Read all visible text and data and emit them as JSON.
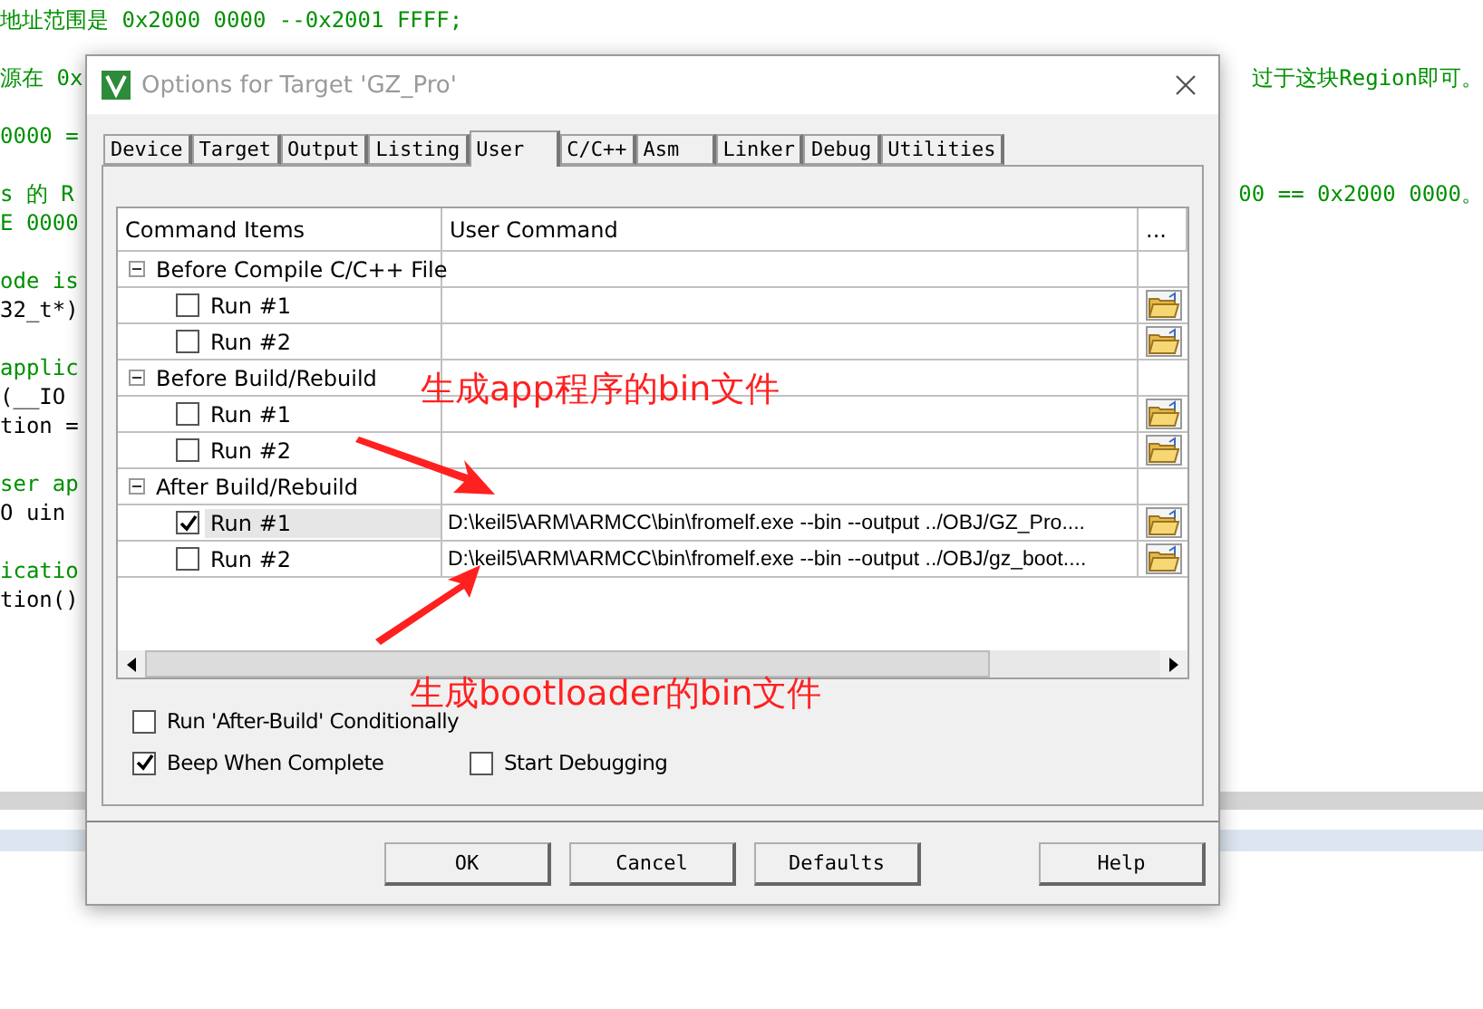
{
  "editor": {
    "blocks": [
      [
        {
          "text": "地址范围是 0x2000 0000  --0x2001 FFFF;",
          "kind": "comment"
        }
      ],
      [
        {
          "text": "源在 0x",
          "kind": "comment",
          "tail": "过于这块Region即可。"
        }
      ],
      [
        {
          "text": "0000 =",
          "kind": "comment"
        }
      ],
      [
        {
          "text": "s 的 R",
          "kind": "comment",
          "tail": "00 == 0x2000 0000。"
        },
        {
          "text": "E 0000",
          "kind": "comment"
        }
      ],
      [
        {
          "text": "ode is",
          "kind": "comment"
        },
        {
          "text": "32_t*)",
          "kind": "code"
        }
      ],
      [
        {
          "text": "applic",
          "kind": "comment"
        },
        {
          "text": "(__IO",
          "kind": "code"
        },
        {
          "text": "tion =",
          "kind": "code"
        }
      ],
      [
        {
          "text": "ser ap",
          "kind": "comment"
        },
        {
          "text": "O uin",
          "kind": "code"
        }
      ],
      [
        {
          "text": "icatio",
          "kind": "comment"
        },
        {
          "text": "tion()",
          "kind": "code"
        }
      ]
    ]
  },
  "dialog": {
    "title": "Options for Target 'GZ_Pro'",
    "tabs": [
      {
        "label": "Device",
        "selected": false
      },
      {
        "label": "Target",
        "selected": false
      },
      {
        "label": "Output",
        "selected": false
      },
      {
        "label": "Listing",
        "selected": false
      },
      {
        "label": "User",
        "selected": true
      },
      {
        "label": "C/C++",
        "selected": false
      },
      {
        "label": "Asm",
        "selected": false
      },
      {
        "label": "Linker",
        "selected": false
      },
      {
        "label": "Debug",
        "selected": false
      },
      {
        "label": "Utilities",
        "selected": false
      }
    ],
    "table": {
      "columns": [
        "Command Items",
        "User Command",
        "..."
      ],
      "groups": [
        {
          "label": "Before Compile C/C++ File",
          "expanded": true,
          "children": [
            {
              "label": "Run #1",
              "checked": false,
              "selected": false
            },
            {
              "label": "Run #2",
              "checked": false,
              "selected": false
            }
          ]
        },
        {
          "label": "Before Build/Rebuild",
          "expanded": true,
          "children": [
            {
              "label": "Run #1",
              "checked": false,
              "selected": false
            },
            {
              "label": "Run #2",
              "checked": false,
              "selected": false
            }
          ]
        },
        {
          "label": "After Build/Rebuild",
          "expanded": true,
          "children": [
            {
              "label": "Run #1",
              "checked": true,
              "selected": true,
              "command": "D:\\keil5\\ARM\\ARMCC\\bin\\fromelf.exe --bin --output  ../OBJ/GZ_Pro...."
            },
            {
              "label": "Run #2",
              "checked": false,
              "selected": false,
              "command": "D:\\keil5\\ARM\\ARMCC\\bin\\fromelf.exe --bin --output  ../OBJ/gz_boot...."
            }
          ]
        }
      ]
    },
    "options": [
      [
        {
          "label": "Run 'After-Build' Conditionally",
          "checked": false
        }
      ],
      [
        {
          "label": "Beep When Complete",
          "checked": true
        },
        {
          "label": "Start Debugging",
          "checked": false
        }
      ]
    ],
    "buttons": [
      {
        "label": "OK",
        "kind": "main"
      },
      {
        "label": "Cancel",
        "kind": "main"
      },
      {
        "label": "Defaults",
        "kind": "main"
      },
      {
        "label": "Help",
        "kind": "help"
      }
    ]
  },
  "annotations": [
    "生成app程序的bin文件",
    "生成bootloader的bin文件"
  ]
}
